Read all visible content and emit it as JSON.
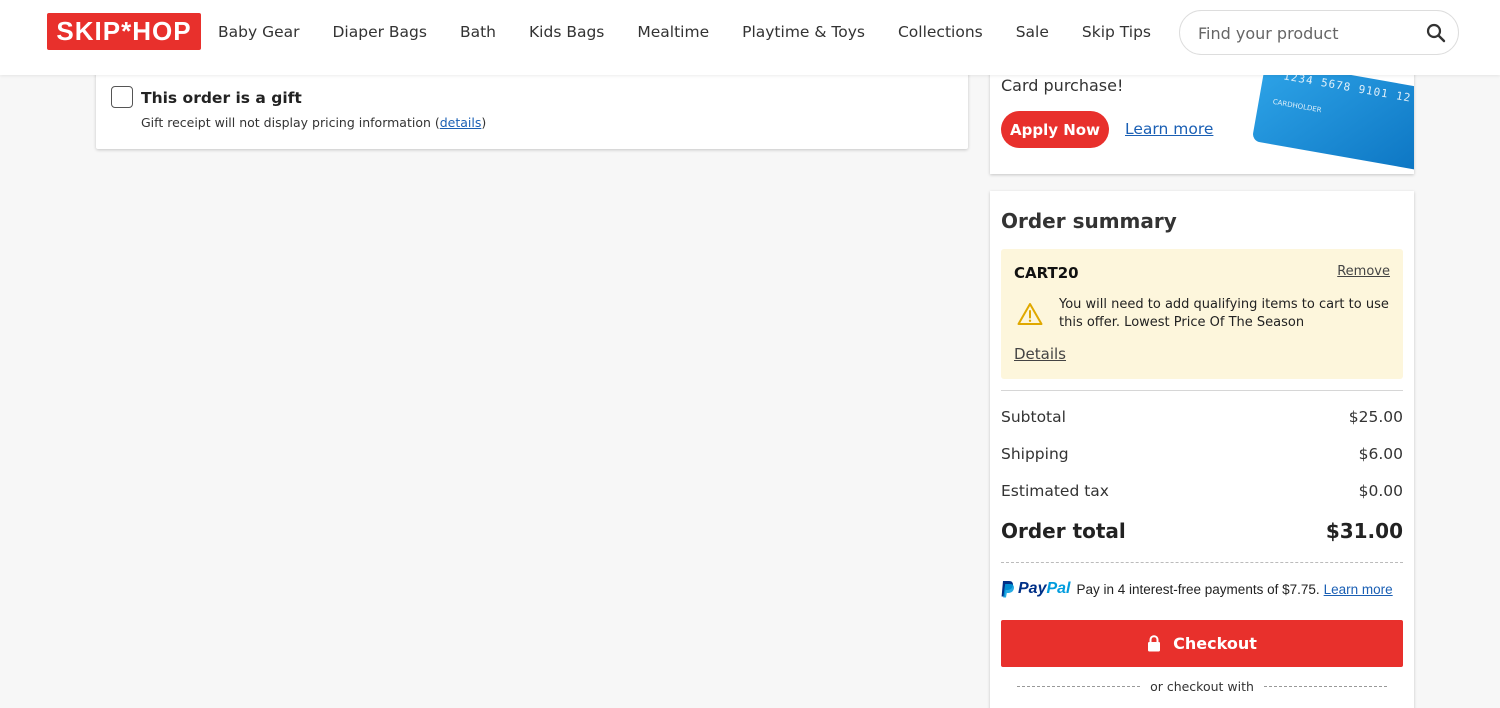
{
  "header": {
    "logo": "SKIP*HOP",
    "nav": [
      "Baby Gear",
      "Diaper Bags",
      "Bath",
      "Kids Bags",
      "Mealtime",
      "Playtime & Toys",
      "Collections",
      "Sale",
      "Skip Tips"
    ],
    "search_placeholder": "Find your product",
    "search_icon": "search-icon"
  },
  "gift": {
    "checked": false,
    "title": "This order is a gift",
    "note_prefix": "Gift receipt will not display pricing information (",
    "note_link": "details",
    "note_suffix": ")"
  },
  "credit_promo": {
    "text": "Card purchase!",
    "apply_label": "Apply Now",
    "learn_label": "Learn more",
    "card_number": "1234 5678 9101 12",
    "card_holder": "CARDHOLDER"
  },
  "summary": {
    "title": "Order summary",
    "promo": {
      "code": "CART20",
      "remove_label": "Remove",
      "message": "You will need to add qualifying items to cart to use this offer. Lowest Price Of The Season",
      "details_label": "Details",
      "warn_color": "#e0a800"
    },
    "subtotal_label": "Subtotal",
    "subtotal_value": "$25.00",
    "shipping_label": "Shipping",
    "shipping_value": "$6.00",
    "tax_label": "Estimated tax",
    "tax_value": "$0.00",
    "total_label": "Order total",
    "total_value": "$31.00",
    "paypal": {
      "logo_pay": "Pay",
      "logo_pal": "Pal",
      "message": "Pay in 4 interest-free payments of $7.75.",
      "learn_label": "Learn more"
    },
    "checkout_label": "Checkout",
    "or_checkout": "or checkout with"
  },
  "colors": {
    "brand_red": "#e8302c",
    "link_blue": "#1a5fb4",
    "promo_bg": "#fdf6dc"
  }
}
